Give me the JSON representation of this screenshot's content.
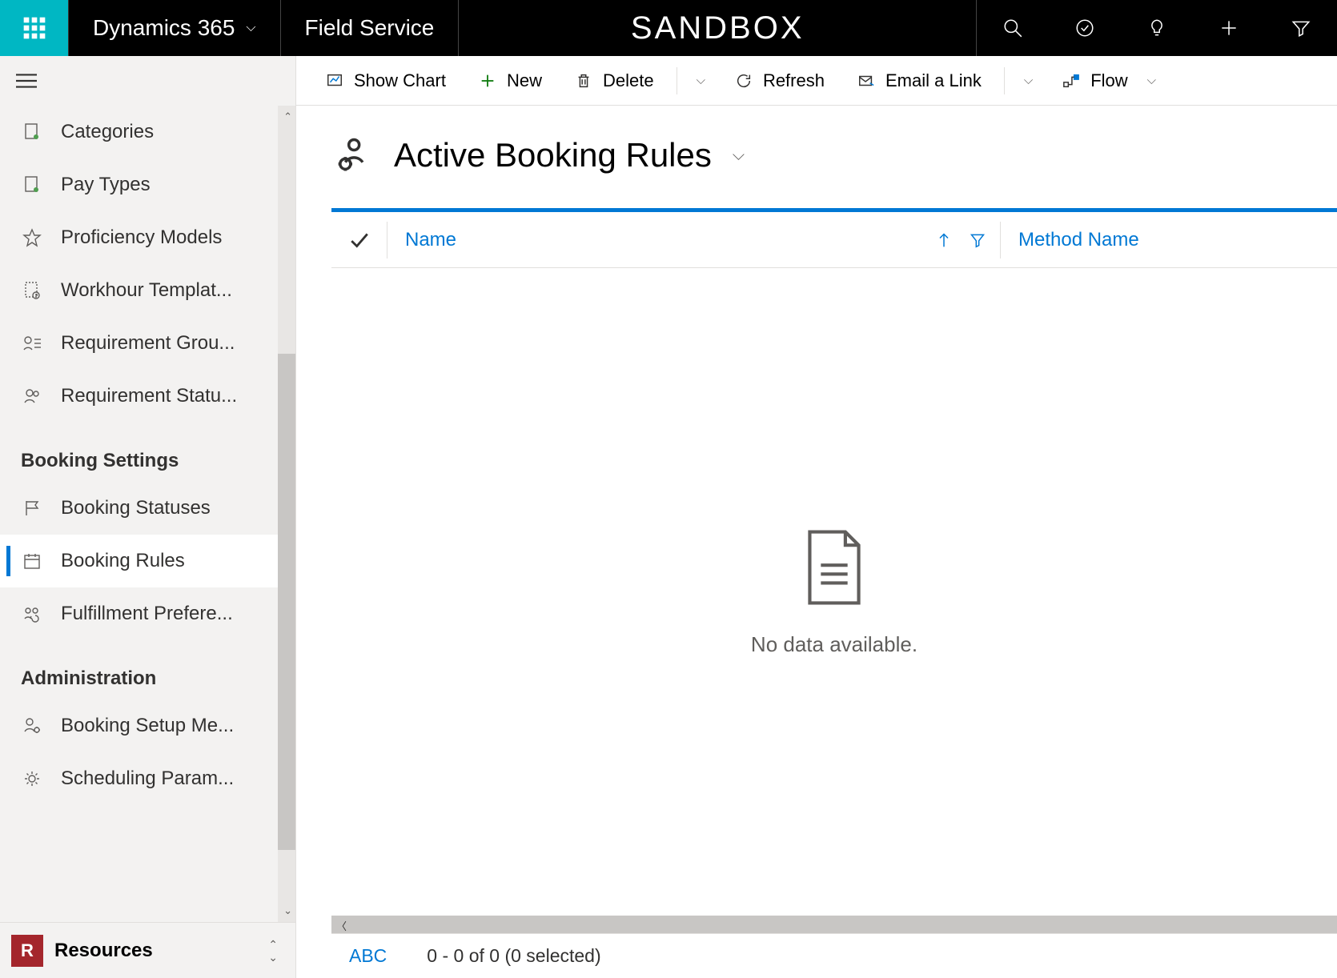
{
  "topbar": {
    "app_name": "Dynamics 365",
    "module": "Field Service",
    "env_label": "SANDBOX"
  },
  "sidebar": {
    "items": [
      {
        "label": "Categories",
        "icon": "doc-person"
      },
      {
        "label": "Pay Types",
        "icon": "doc-person"
      },
      {
        "label": "Proficiency Models",
        "icon": "star"
      },
      {
        "label": "Workhour Templat...",
        "icon": "doc-clock"
      },
      {
        "label": "Requirement Grou...",
        "icon": "person-list"
      },
      {
        "label": "Requirement Statu...",
        "icon": "people"
      }
    ],
    "group1_title": "Booking Settings",
    "group1": [
      {
        "label": "Booking Statuses",
        "icon": "flag"
      },
      {
        "label": "Booking Rules",
        "icon": "calendar",
        "active": true
      },
      {
        "label": "Fulfillment Prefere...",
        "icon": "people-sync"
      }
    ],
    "group2_title": "Administration",
    "group2": [
      {
        "label": "Booking Setup Me...",
        "icon": "people-gear"
      },
      {
        "label": "Scheduling Param...",
        "icon": "gear"
      }
    ],
    "area_badge": "R",
    "area_label": "Resources"
  },
  "commands": {
    "show_chart": "Show Chart",
    "new": "New",
    "delete": "Delete",
    "refresh": "Refresh",
    "email_link": "Email a Link",
    "flow": "Flow"
  },
  "view": {
    "title": "Active Booking Rules",
    "col_name": "Name",
    "col_method": "Method Name",
    "empty_text": "No data available.",
    "footer_abc": "ABC",
    "footer_count": "0 - 0 of 0 (0 selected)"
  }
}
